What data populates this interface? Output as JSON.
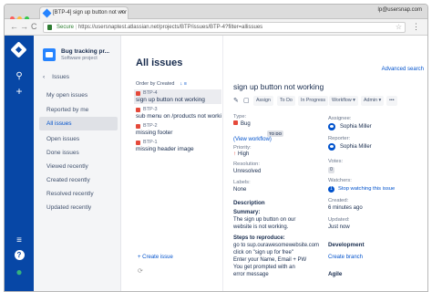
{
  "browser": {
    "tab_title": "[BTP-4] sign up button not wor",
    "tab_close": "×",
    "profile": "lp@usersnap.com",
    "back": "←",
    "forward": "→",
    "reload": "C",
    "secure_label": "Secure",
    "url": "https://usersnaptest.atlassian.net/projects/BTP/issues/BTP-4?filter=allissues",
    "star": "☆",
    "menu": "⋮"
  },
  "global_nav": {
    "search": "⚲",
    "create": "+",
    "menu": "≡",
    "help": "?",
    "profile": "●"
  },
  "project_nav": {
    "project_name": "Bug tracking pr...",
    "project_type": "Software project",
    "back_label": "Issues",
    "back_arrow": "‹",
    "items": [
      {
        "label": "My open issues"
      },
      {
        "label": "Reported by me"
      },
      {
        "label": "All issues"
      },
      {
        "label": "Open issues"
      },
      {
        "label": "Done issues"
      },
      {
        "label": "Viewed recently"
      },
      {
        "label": "Created recently"
      },
      {
        "label": "Resolved recently"
      },
      {
        "label": "Updated recently"
      }
    ]
  },
  "issue_list": {
    "title": "All issues",
    "order_label": "Order by Created",
    "order_arrows": "↓ ≡",
    "issues": [
      {
        "key": "BTP-4",
        "summary": "sign up button not working"
      },
      {
        "key": "BTP-3",
        "summary": "sub menu on /products not working"
      },
      {
        "key": "BTP-2",
        "summary": "missing footer"
      },
      {
        "key": "BTP-1",
        "summary": "missing header image"
      }
    ],
    "create_link": "+ Create issue",
    "loading": "⟳"
  },
  "issue_detail": {
    "advanced_search": "Advanced search",
    "title": "sign up button not working",
    "toolbar": {
      "edit_icon": "✎",
      "comment_icon": "▢",
      "assign": "Assign",
      "todo": "To Do",
      "in_progress": "In Progress",
      "workflow": "Workflow ▾",
      "admin": "Admin ▾",
      "more": "•••"
    },
    "type_label": "Type:",
    "type_value": "Bug",
    "status_lozenge": "TO DO",
    "view_workflow": "(View workflow)",
    "priority_label": "Priority:",
    "priority_value": "High",
    "priority_arrow": "↑",
    "resolution_label": "Resolution:",
    "resolution_value": "Unresolved",
    "labels_label": "Labels:",
    "labels_value": "None",
    "description_heading": "Description",
    "description_lines": [
      "Summary:",
      "The sign up button on our",
      "website is not working."
    ],
    "steps_heading": "Steps to reproduce:",
    "steps_lines": [
      "go to sup.ourawesomewebsite.com",
      "click on \"sign up for free\"",
      "Enter your Name, Email + PW",
      "You get prompted with an",
      "error message"
    ],
    "assignee_label": "Assignee:",
    "assignee_value": "Sophia Miller",
    "reporter_label": "Reporter:",
    "reporter_value": "Sophia Miller",
    "votes_label": "Votes:",
    "votes_value": "0",
    "watchers_label": "Watchers:",
    "watchers_value": "1",
    "watchers_link": "Stop watching this issue",
    "created_label": "Created:",
    "created_value": "6 minutes ago",
    "updated_label": "Updated:",
    "updated_value": "Just now",
    "development_heading": "Development",
    "create_branch": "Create branch",
    "agile_heading": "Agile"
  }
}
